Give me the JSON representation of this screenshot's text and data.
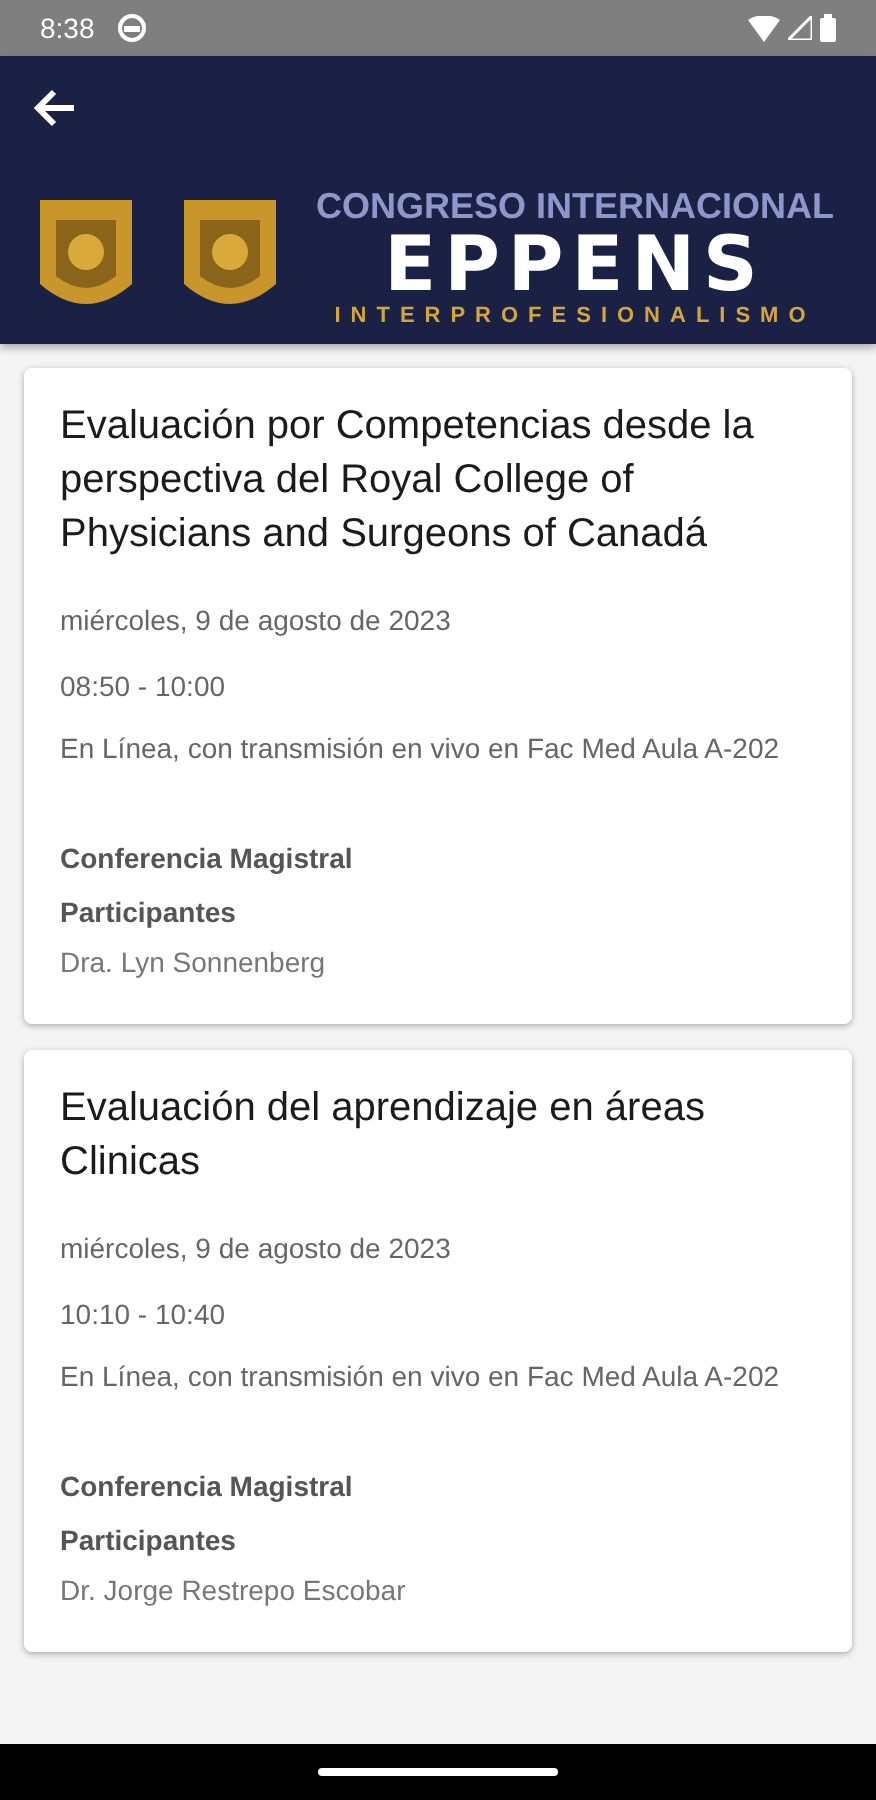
{
  "status_bar": {
    "time": "8:38"
  },
  "banner": {
    "line_1": "CONGRESO INTERNACIONAL",
    "line_2": "EPPENS",
    "line_3": "INTERPROFESIONALISMO"
  },
  "sessions": [
    {
      "title": "Evaluación por Competencias desde la perspectiva del Royal College of Physicians and Surgeons of Canadá",
      "date": "miércoles, 9 de agosto de 2023",
      "time": "08:50 - 10:00",
      "location": "En Línea, con transmisión en vivo en Fac Med Aula A-202",
      "type": "Conferencia Magistral",
      "participants_label": "Participantes",
      "participants": "Dra. Lyn Sonnenberg"
    },
    {
      "title": "Evaluación del aprendizaje en áreas Clinicas",
      "date": "miércoles, 9 de agosto de 2023",
      "time": "10:10 - 10:40",
      "location": "En Línea, con transmisión en vivo en Fac Med Aula A-202",
      "type": "Conferencia Magistral",
      "participants_label": "Participantes",
      "participants": "Dr. Jorge Restrepo Escobar"
    }
  ]
}
